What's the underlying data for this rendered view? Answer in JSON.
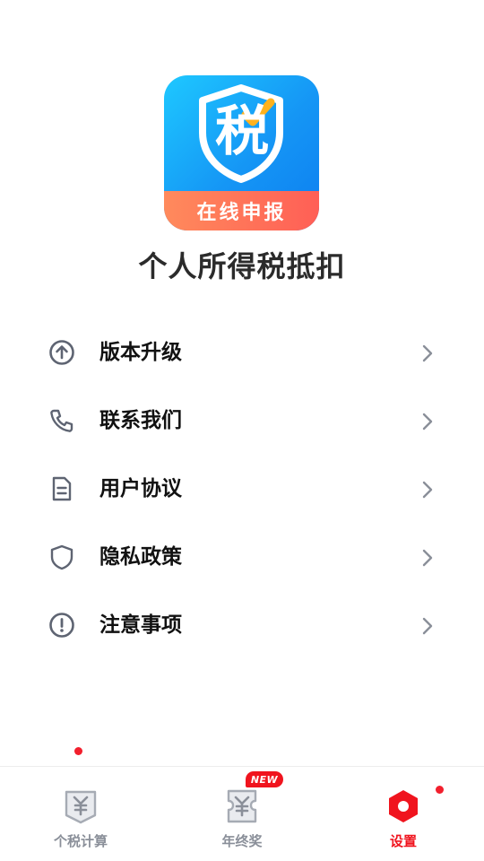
{
  "app": {
    "icon_char": "税",
    "icon_banner": "在线申报",
    "name": "个人所得税抵扣"
  },
  "menu": {
    "items": [
      {
        "label": "版本升级",
        "icon": "arrow-up-circle-icon",
        "has_badge": false
      },
      {
        "label": "联系我们",
        "icon": "phone-icon",
        "has_badge": false
      },
      {
        "label": "用户协议",
        "icon": "document-icon",
        "has_badge": false
      },
      {
        "label": "隐私政策",
        "icon": "shield-icon",
        "has_badge": true
      },
      {
        "label": "注意事项",
        "icon": "alert-circle-icon",
        "has_badge": false
      }
    ]
  },
  "tabbar": {
    "tabs": [
      {
        "label": "个税计算",
        "icon": "yuan-badge-icon",
        "active": false
      },
      {
        "label": "年终奖",
        "icon": "yuan-ticket-icon",
        "active": false,
        "badge": "NEW"
      },
      {
        "label": "设置",
        "icon": "settings-hexagon-icon",
        "active": true,
        "dot": true
      }
    ]
  },
  "colors": {
    "accent": "#f0141e",
    "icon_gray": "#5e6472",
    "chevron_gray": "#8a8f99",
    "app_icon_blue": "#1596f5",
    "app_icon_orange": "#ff6b57"
  }
}
